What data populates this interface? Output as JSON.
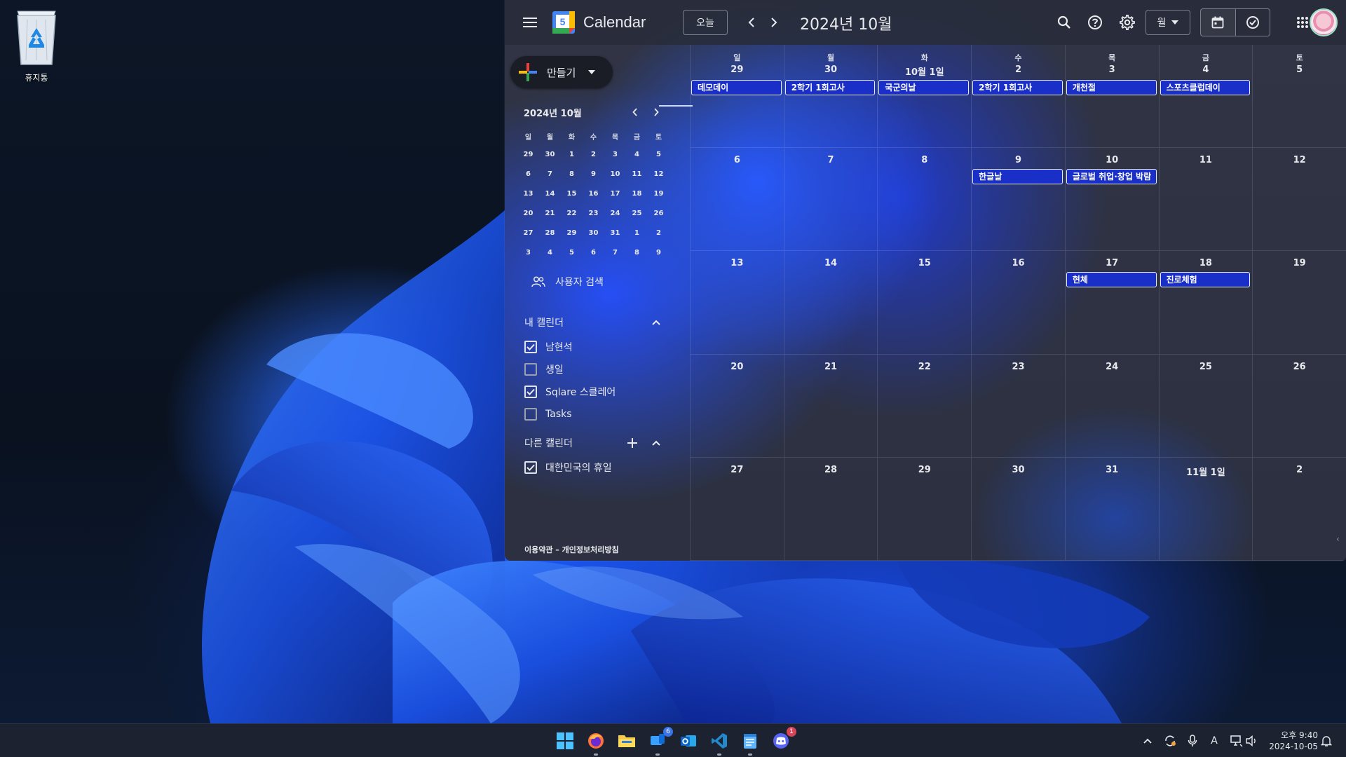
{
  "desktop": {
    "recycle_bin_label": "휴지통"
  },
  "calendar": {
    "app_title": "Calendar",
    "logo_day": "5",
    "today_label": "오늘",
    "period_title": "2024년 10월",
    "view_select": "월",
    "create_label": "만들기",
    "mini_calendar": {
      "title": "2024년 10월",
      "weekdays": [
        "일",
        "월",
        "화",
        "수",
        "목",
        "금",
        "토"
      ],
      "days": [
        "29",
        "30",
        "1",
        "2",
        "3",
        "4",
        "5",
        "6",
        "7",
        "8",
        "9",
        "10",
        "11",
        "12",
        "13",
        "14",
        "15",
        "16",
        "17",
        "18",
        "19",
        "20",
        "21",
        "22",
        "23",
        "24",
        "25",
        "26",
        "27",
        "28",
        "29",
        "30",
        "31",
        "1",
        "2",
        "3",
        "4",
        "5",
        "6",
        "7",
        "8",
        "9"
      ]
    },
    "user_search_label": "사용자 검색",
    "my_calendars": {
      "title": "내 캘린더",
      "items": [
        {
          "label": "남현석",
          "checked": true
        },
        {
          "label": "생일",
          "checked": false
        },
        {
          "label": "Sqlare 스클레어",
          "checked": true
        },
        {
          "label": "Tasks",
          "checked": false
        }
      ]
    },
    "other_calendars": {
      "title": "다른 캘린더",
      "items": [
        {
          "label": "대한민국의 휴일",
          "checked": true
        }
      ]
    },
    "footer": "이용약관 – 개인정보처리방침",
    "month": {
      "weekdays": [
        "일",
        "월",
        "화",
        "수",
        "목",
        "금",
        "토"
      ],
      "weeks": [
        [
          "29",
          "30",
          "10월 1일",
          "2",
          "3",
          "4",
          "5"
        ],
        [
          "6",
          "7",
          "8",
          "9",
          "10",
          "11",
          "12"
        ],
        [
          "13",
          "14",
          "15",
          "16",
          "17",
          "18",
          "19"
        ],
        [
          "20",
          "21",
          "22",
          "23",
          "24",
          "25",
          "26"
        ],
        [
          "27",
          "28",
          "29",
          "30",
          "31",
          "11월 1일",
          "2"
        ]
      ],
      "events": [
        {
          "week": 0,
          "day": 0,
          "title": "데모데이"
        },
        {
          "week": 0,
          "day": 1,
          "title": "2학기 1회고사"
        },
        {
          "week": 0,
          "day": 2,
          "title": "국군의날"
        },
        {
          "week": 0,
          "day": 3,
          "title": "2학기 1회고사"
        },
        {
          "week": 0,
          "day": 4,
          "title": "개천절"
        },
        {
          "week": 0,
          "day": 5,
          "title": "스포츠클럽데이"
        },
        {
          "week": 1,
          "day": 3,
          "title": "한글날"
        },
        {
          "week": 1,
          "day": 4,
          "title": "글로벌 취업·창업 박람"
        },
        {
          "week": 2,
          "day": 4,
          "title": "현체"
        },
        {
          "week": 2,
          "day": 5,
          "title": "진로체험"
        }
      ]
    }
  },
  "taskbar": {
    "badges": {
      "phone_link": "6",
      "discord": "1"
    },
    "clock_time": "오후 9:40",
    "clock_date": "2024-10-05",
    "ime_label": "A"
  },
  "colors": {
    "event_bg": "#1a2fc8",
    "accent": "#8ab4f8"
  }
}
